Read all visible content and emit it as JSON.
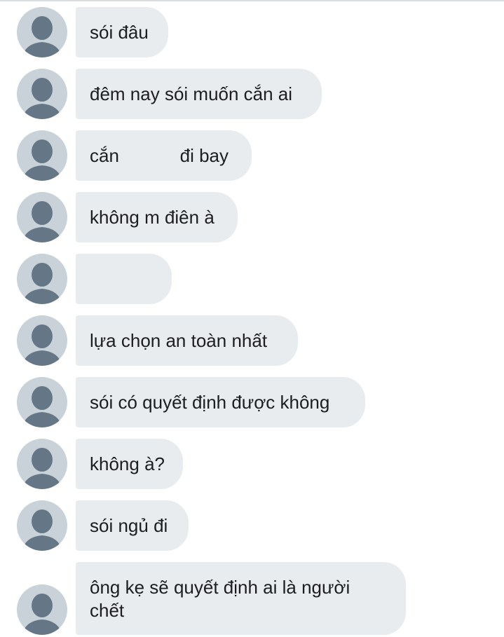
{
  "messages": [
    {
      "text": "sói đâu"
    },
    {
      "text": "đêm nay sói muốn cắn ai"
    },
    {
      "text": "cắn            đi bay"
    },
    {
      "text": "không m điên à"
    },
    {
      "text": ""
    },
    {
      "text": "lựa chọn an toàn nhất"
    },
    {
      "text": "sói có quyết định được không"
    },
    {
      "text": "không à?"
    },
    {
      "text": "sói ngủ đi"
    },
    {
      "text": "ông kẹ sẽ quyết định ai là người chết"
    }
  ],
  "avatar_icon": "default-person-avatar-icon",
  "colors": {
    "bubble": "#e8ecef",
    "avatar_bg": "#c9d2d8",
    "avatar_fg": "#657786",
    "text": "#1c1e21"
  }
}
